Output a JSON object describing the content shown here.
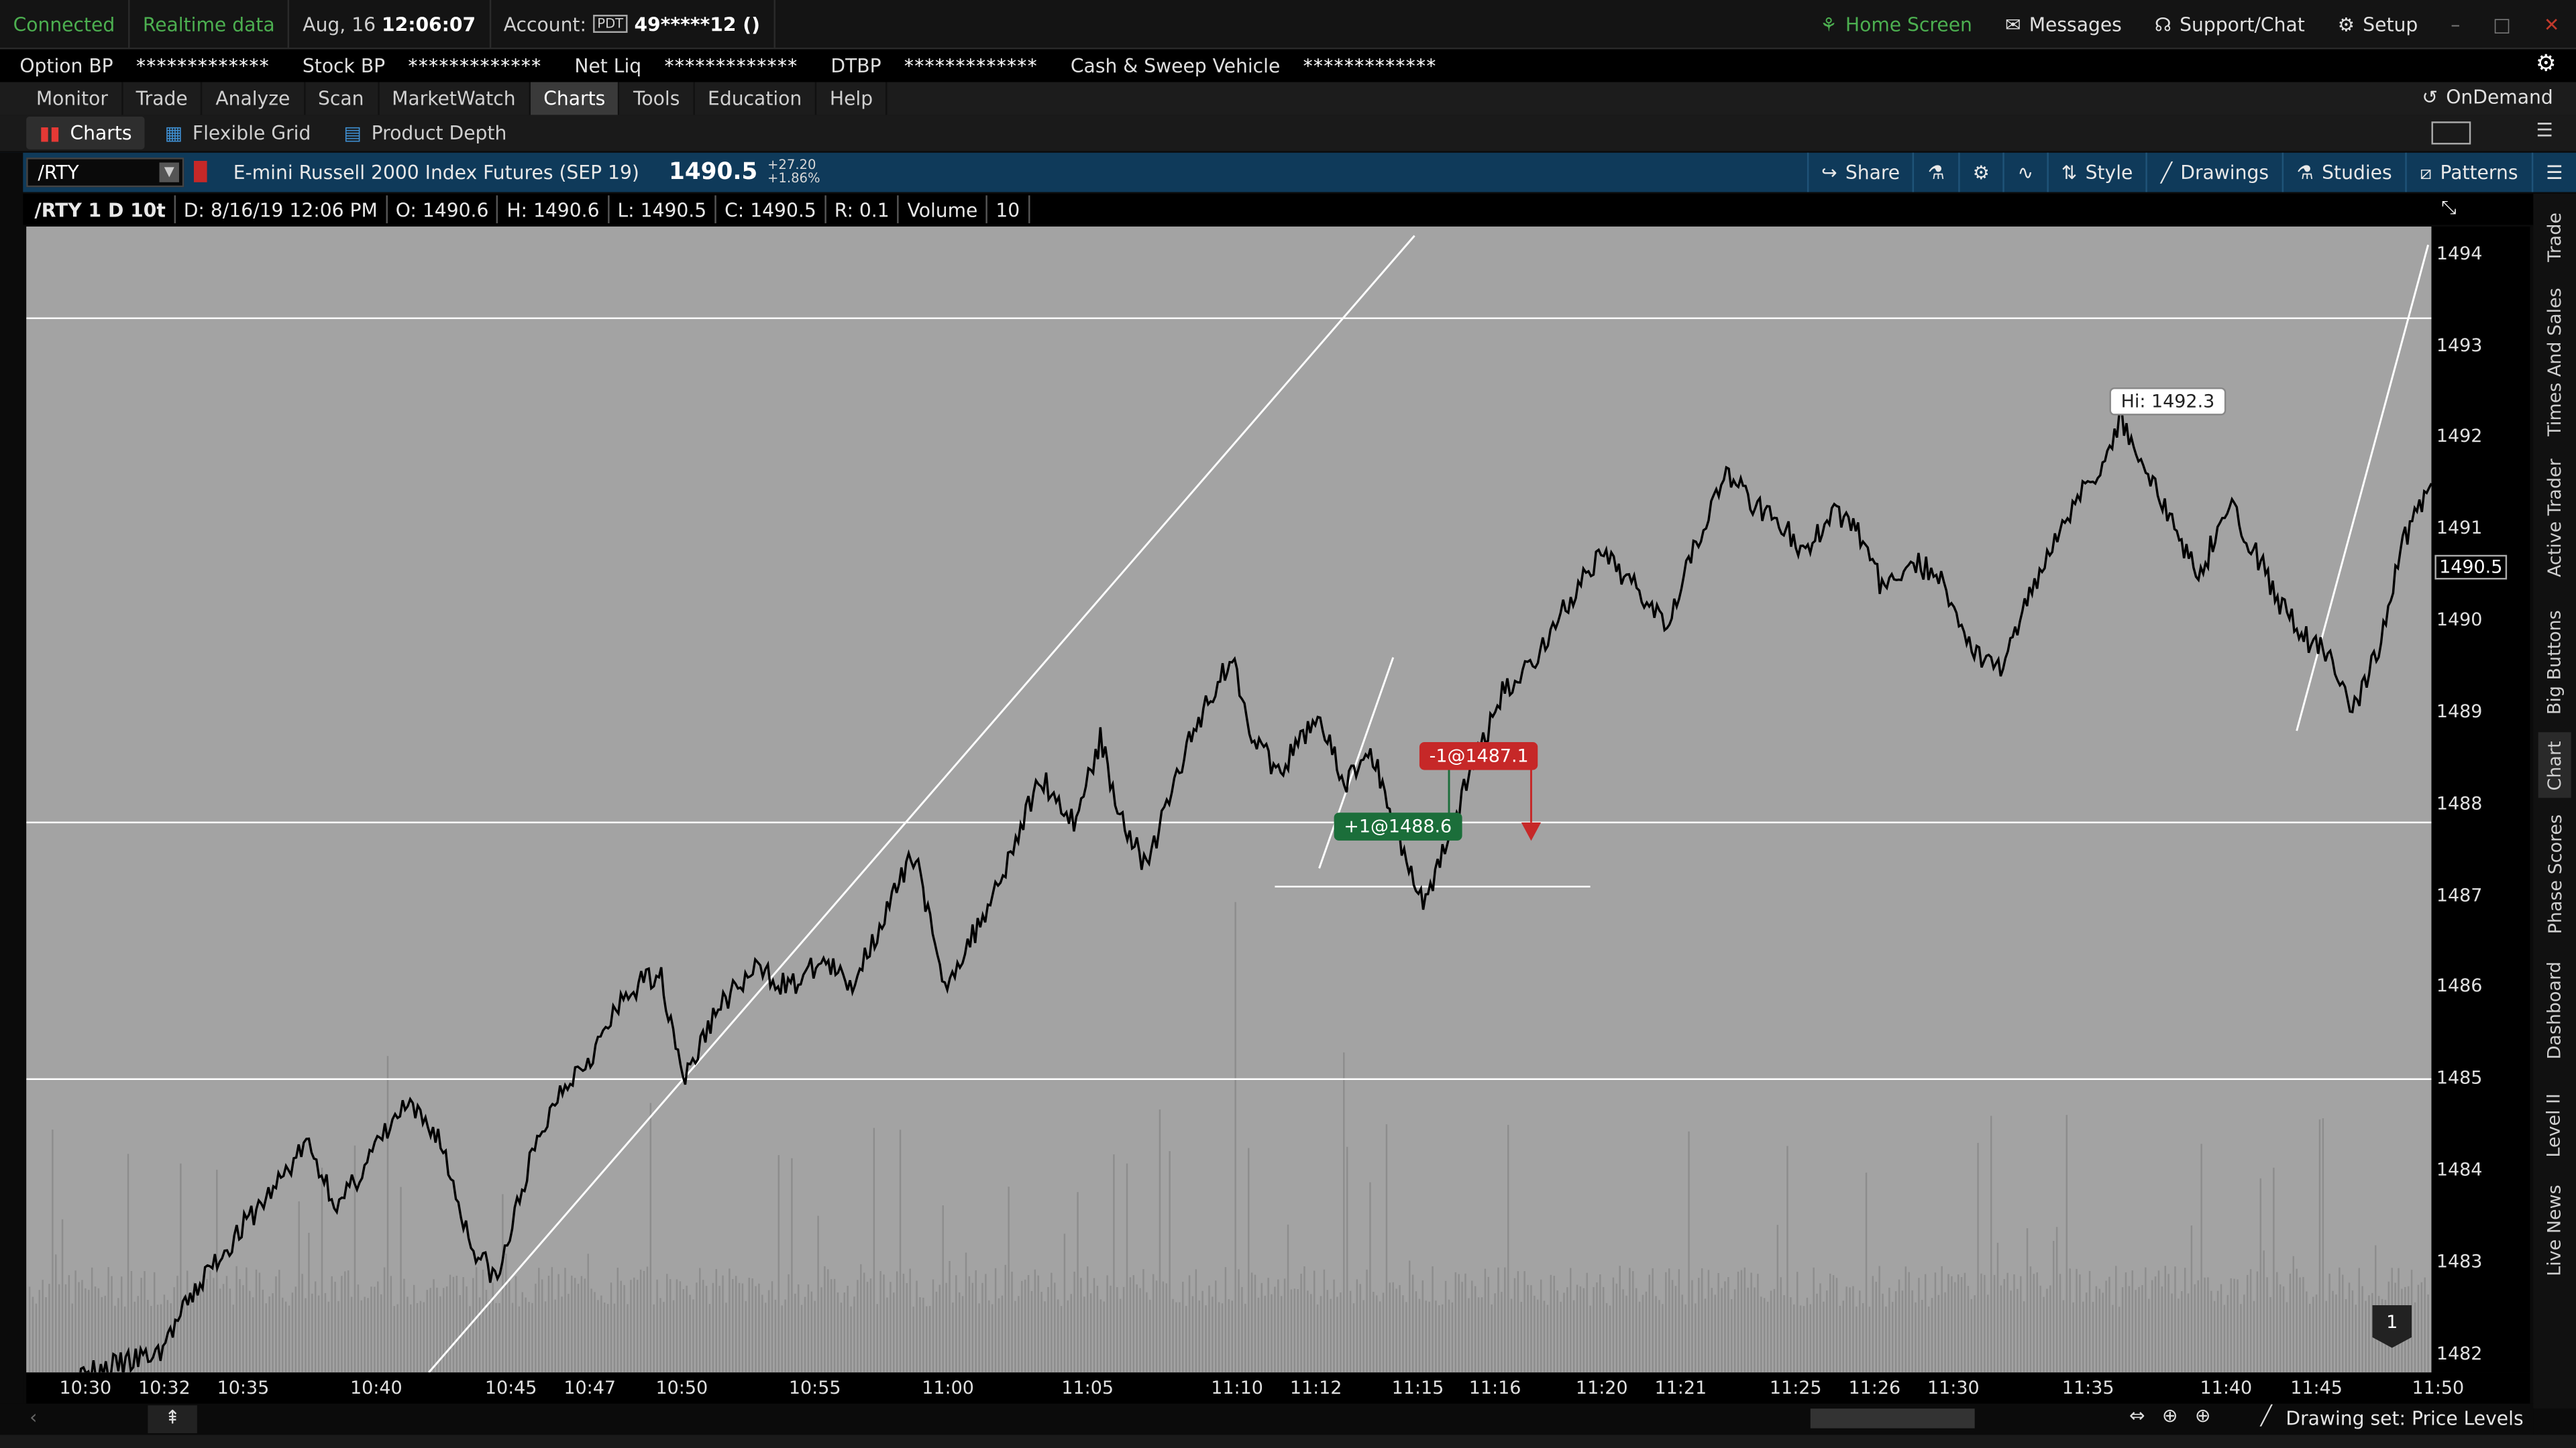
{
  "status": {
    "connected": "Connected",
    "realtime": "Realtime data",
    "date": "Aug, 16",
    "time": "12:06:07",
    "account_label": "Account:",
    "account_badge": "PDT",
    "account_value": "49*****12 ()",
    "home": "Home Screen",
    "messages": "Messages",
    "support": "Support/Chat",
    "setup": "Setup"
  },
  "balances": [
    {
      "label": "Option BP",
      "value": "*************"
    },
    {
      "label": "Stock BP",
      "value": "*************"
    },
    {
      "label": "Net Liq",
      "value": "*************"
    },
    {
      "label": "DTBP",
      "value": "*************"
    },
    {
      "label": "Cash & Sweep Vehicle",
      "value": "*************"
    }
  ],
  "menu": [
    "Monitor",
    "Trade",
    "Analyze",
    "Scan",
    "MarketWatch",
    "Charts",
    "Tools",
    "Education",
    "Help"
  ],
  "menu_active": "Charts",
  "ondemand": "OnDemand",
  "subtabs": [
    "Charts",
    "Flexible Grid",
    "Product Depth"
  ],
  "toolbar": {
    "symbol": "/RTY",
    "description": "E-mini Russell 2000 Index Futures (SEP 19)",
    "last": "1490.5",
    "change": "+27.20",
    "change_pct": "+1.86%",
    "share": "Share",
    "style": "Style",
    "drawings": "Drawings",
    "studies": "Studies",
    "patterns": "Patterns"
  },
  "infobar": {
    "agg": "/RTY 1 D 10t",
    "d": "D: 8/16/19 12:06 PM",
    "o": "O: 1490.6",
    "h": "H: 1490.6",
    "l": "L: 1490.5",
    "c": "C: 1490.5",
    "r": "R: 0.1",
    "volume_label": "Volume",
    "volume": "10"
  },
  "chart_data": {
    "type": "line",
    "title": "",
    "xlabel": "",
    "ylabel": "",
    "ylim": [
      1481.8,
      1494.3
    ],
    "y_ticks": [
      "1494",
      "1493",
      "1492",
      "1491",
      "1490",
      "1489",
      "1488",
      "1487",
      "1486",
      "1485",
      "1484",
      "1483",
      "1482"
    ],
    "x_ticks": [
      "10:30",
      "10:32",
      "10:35",
      "10:40",
      "10:45",
      "10:47",
      "10:50",
      "10:55",
      "11:00",
      "11:05",
      "11:10",
      "11:12",
      "11:15",
      "11:16",
      "11:20",
      "11:21",
      "11:25",
      "11:26",
      "11:30",
      "11:35",
      "11:40",
      "11:45",
      "11:50"
    ],
    "price_path": [
      [
        0,
        1481.6
      ],
      [
        40,
        1482.0
      ],
      [
        55,
        1482.9
      ],
      [
        75,
        1483.8
      ],
      [
        85,
        1484.3
      ],
      [
        95,
        1483.6
      ],
      [
        105,
        1484.2
      ],
      [
        115,
        1484.7
      ],
      [
        125,
        1484.4
      ],
      [
        135,
        1483.2
      ],
      [
        143,
        1482.8
      ],
      [
        152,
        1484.0
      ],
      [
        162,
        1484.9
      ],
      [
        172,
        1485.3
      ],
      [
        182,
        1485.9
      ],
      [
        192,
        1486.2
      ],
      [
        200,
        1485.0
      ],
      [
        210,
        1485.8
      ],
      [
        222,
        1486.2
      ],
      [
        232,
        1486.0
      ],
      [
        242,
        1486.3
      ],
      [
        250,
        1486.0
      ],
      [
        262,
        1486.9
      ],
      [
        270,
        1487.5
      ],
      [
        278,
        1486.0
      ],
      [
        288,
        1486.6
      ],
      [
        298,
        1487.4
      ],
      [
        308,
        1488.3
      ],
      [
        318,
        1487.8
      ],
      [
        326,
        1488.7
      ],
      [
        332,
        1487.9
      ],
      [
        340,
        1487.3
      ],
      [
        350,
        1488.4
      ],
      [
        358,
        1489.1
      ],
      [
        366,
        1489.6
      ],
      [
        372,
        1488.8
      ],
      [
        380,
        1488.3
      ],
      [
        392,
        1489.0
      ],
      [
        400,
        1488.2
      ],
      [
        408,
        1488.6
      ],
      [
        416,
        1487.7
      ],
      [
        424,
        1486.9
      ],
      [
        432,
        1487.7
      ],
      [
        440,
        1488.5
      ],
      [
        448,
        1489.2
      ],
      [
        458,
        1489.6
      ],
      [
        468,
        1490.2
      ],
      [
        478,
        1490.7
      ],
      [
        488,
        1490.4
      ],
      [
        498,
        1490.0
      ],
      [
        506,
        1490.8
      ],
      [
        516,
        1491.6
      ],
      [
        524,
        1491.3
      ],
      [
        532,
        1491.1
      ],
      [
        540,
        1490.7
      ],
      [
        548,
        1491.2
      ],
      [
        556,
        1491.0
      ],
      [
        564,
        1490.3
      ],
      [
        572,
        1490.7
      ],
      [
        582,
        1490.4
      ],
      [
        592,
        1489.6
      ],
      [
        600,
        1489.5
      ],
      [
        608,
        1490.3
      ],
      [
        618,
        1491.1
      ],
      [
        628,
        1491.6
      ],
      [
        636,
        1492.2
      ],
      [
        644,
        1491.6
      ],
      [
        652,
        1491.0
      ],
      [
        660,
        1490.5
      ],
      [
        668,
        1491.3
      ],
      [
        676,
        1490.8
      ],
      [
        684,
        1490.2
      ],
      [
        692,
        1489.8
      ],
      [
        700,
        1489.6
      ],
      [
        706,
        1489.0
      ],
      [
        714,
        1489.7
      ],
      [
        722,
        1490.9
      ],
      [
        730,
        1491.5
      ]
    ],
    "volume_bars": "gray histogram along bottom",
    "horizontal_lines": [
      1493.3,
      1487.8,
      1485.0
    ],
    "annotations": {
      "high_label": "Hi: 1492.3",
      "sell_fill": "-1@1487.1",
      "buy_fill": "+1@1488.6",
      "price_tag": "1490.5",
      "marker": "1"
    }
  },
  "rail": [
    "Trade",
    "Times And Sales",
    "Active Trader",
    "Big Buttons",
    "Chart",
    "Phase Scores",
    "Dashboard",
    "Level II",
    "Live News"
  ],
  "bottom": {
    "drawing_set": "Drawing set: Price Levels"
  },
  "colors": {
    "connected": "#4caf50",
    "toolbar_bg": "#0f3a5a",
    "plot_bg": "#a3a3a3",
    "sell_tag": "#c62828",
    "buy_tag": "#1b6e3a"
  }
}
